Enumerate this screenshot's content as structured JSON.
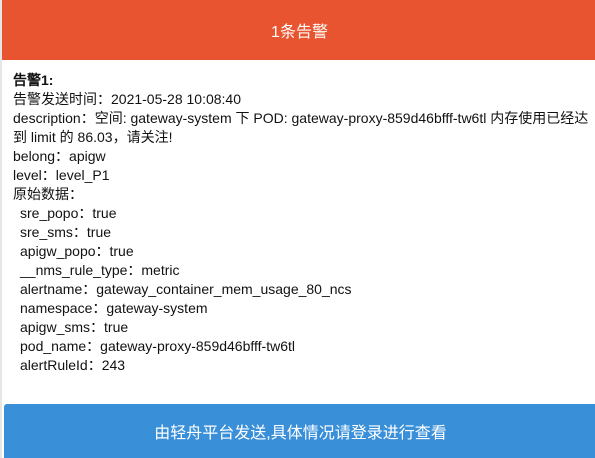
{
  "header": {
    "title": "1条告警"
  },
  "alert": {
    "title": "告警1:",
    "send_time": "告警发送时间：2021-05-28 10:08:40",
    "description": "description：空间: gateway-system 下 POD: gateway-proxy-859d46bfff-tw6tl 内存使用已经达到 limit 的 86.03，请关注!",
    "belong": "belong：apigw",
    "level": "level：level_P1",
    "raw_label": "原始数据：",
    "raw": [
      "sre_popo：true",
      "sre_sms：true",
      "apigw_popo：true",
      "__nms_rule_type：metric",
      "alertname：gateway_container_mem_usage_80_ncs",
      "namespace：gateway-system",
      "apigw_sms：true",
      "pod_name：gateway-proxy-859d46bfff-tw6tl",
      "alertRuleId：243"
    ]
  },
  "footer": {
    "text": "由轻舟平台发送,具体情况请登录进行查看"
  },
  "colors": {
    "header": "#e8542f",
    "footer": "#3a8fd9"
  }
}
